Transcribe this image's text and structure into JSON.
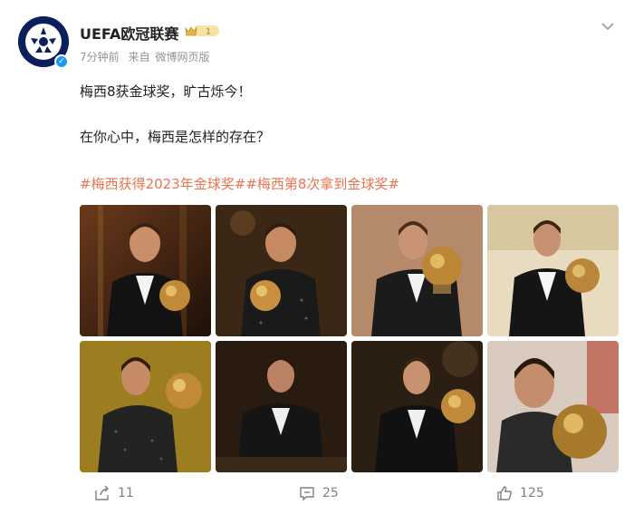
{
  "post": {
    "author": "UEFA欧冠联赛",
    "vip_level": "1",
    "time": "7分钟前",
    "source_prefix": "来自",
    "source": "微博网页版",
    "line1": "梅西8获金球奖，旷古烁今！",
    "line2": "在你心中，梅西是怎样的存在？",
    "hashtags": "#梅西获得2023年金球奖##梅西第8次拿到金球奖#"
  },
  "toolbar": {
    "repost_count": "11",
    "comment_count": "25",
    "like_count": "125"
  },
  "icons": {
    "repost": "share-icon",
    "comment": "comment-icon",
    "like": "thumbs-up-icon",
    "more": "chevron-down-icon"
  },
  "colors": {
    "hashtag": "#eb7350",
    "meta": "#939393",
    "verified": "#1d9bf0",
    "vip_gold": "#e6b84a"
  }
}
